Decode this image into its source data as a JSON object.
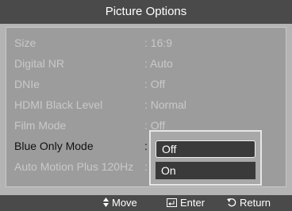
{
  "menu": {
    "title": "Picture Options",
    "rows": [
      {
        "label": "Size",
        "value": ": 16:9"
      },
      {
        "label": "Digital NR",
        "value": ": Auto"
      },
      {
        "label": "DNIe",
        "value": ": Off"
      },
      {
        "label": "HDMI Black Level",
        "value": ": Normal"
      },
      {
        "label": "Film Mode",
        "value": ": Off"
      },
      {
        "label": "Blue Only Mode",
        "value": ":"
      },
      {
        "label": "Auto Motion Plus 120Hz",
        "value": ":"
      }
    ],
    "active_row": "Blue Only Mode"
  },
  "dropdown": {
    "options": [
      "Off",
      "On"
    ],
    "selected": "Off"
  },
  "footer": {
    "move_icon": "up-down-arrow-icon",
    "move_label": "Move",
    "enter_icon": "enter-icon",
    "enter_label": "Enter",
    "return_icon": "return-icon",
    "return_label": "Return"
  },
  "colors": {
    "header_bg": "#4a4a4a",
    "panel_bg": "#9c9c9c",
    "inactive_text": "#c9c9c9",
    "active_text": "#111111",
    "selected_option_bg": "#3a3a3a"
  }
}
